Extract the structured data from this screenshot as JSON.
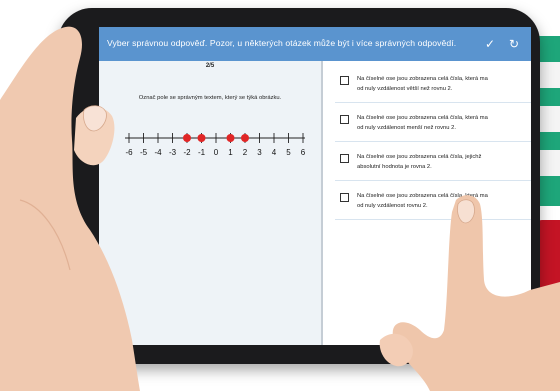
{
  "header": {
    "title": "Vyber správnou odpověď. Pozor, u některých otázek může být i více správných odpovědí.",
    "check_icon": "check-icon",
    "refresh_icon": "refresh-icon"
  },
  "question": {
    "progress": "2/5",
    "prompt": "Označ pole se správným textem, který se týká obrázku."
  },
  "number_line": {
    "labels": [
      "-6",
      "-5",
      "-4",
      "-3",
      "-2",
      "-1",
      "0",
      "1",
      "2",
      "3",
      "4",
      "5",
      "6"
    ],
    "marked": [
      -2,
      -1,
      1,
      2
    ],
    "marker_color": "#e02626"
  },
  "options": [
    {
      "line1": "Na číselné ose jsou zobrazena celá čísla, která ma",
      "line2": "od nuly vzdálenost větší než rovnu 2.",
      "checked": false
    },
    {
      "line1": "Na číselné ose jsou zobrazena celá čísla, která ma",
      "line2": "od nuly vzdálenost menší než rovnu 2.",
      "checked": false
    },
    {
      "line1": "Na číselné ose jsou zobrazena celá čísla, jejichž",
      "line2": "absolutní hodnota je rovna 2.",
      "checked": false
    },
    {
      "line1": "Na číselné ose jsou zobrazena celá čísla, která ma",
      "line2": "od nuly vzdálenost rovnu 2.",
      "checked": false
    }
  ],
  "colors": {
    "header_bg": "#5a94cf",
    "accent_orange": "#e8561f",
    "green_card": "#1ea67a",
    "red_card": "#c41425"
  }
}
